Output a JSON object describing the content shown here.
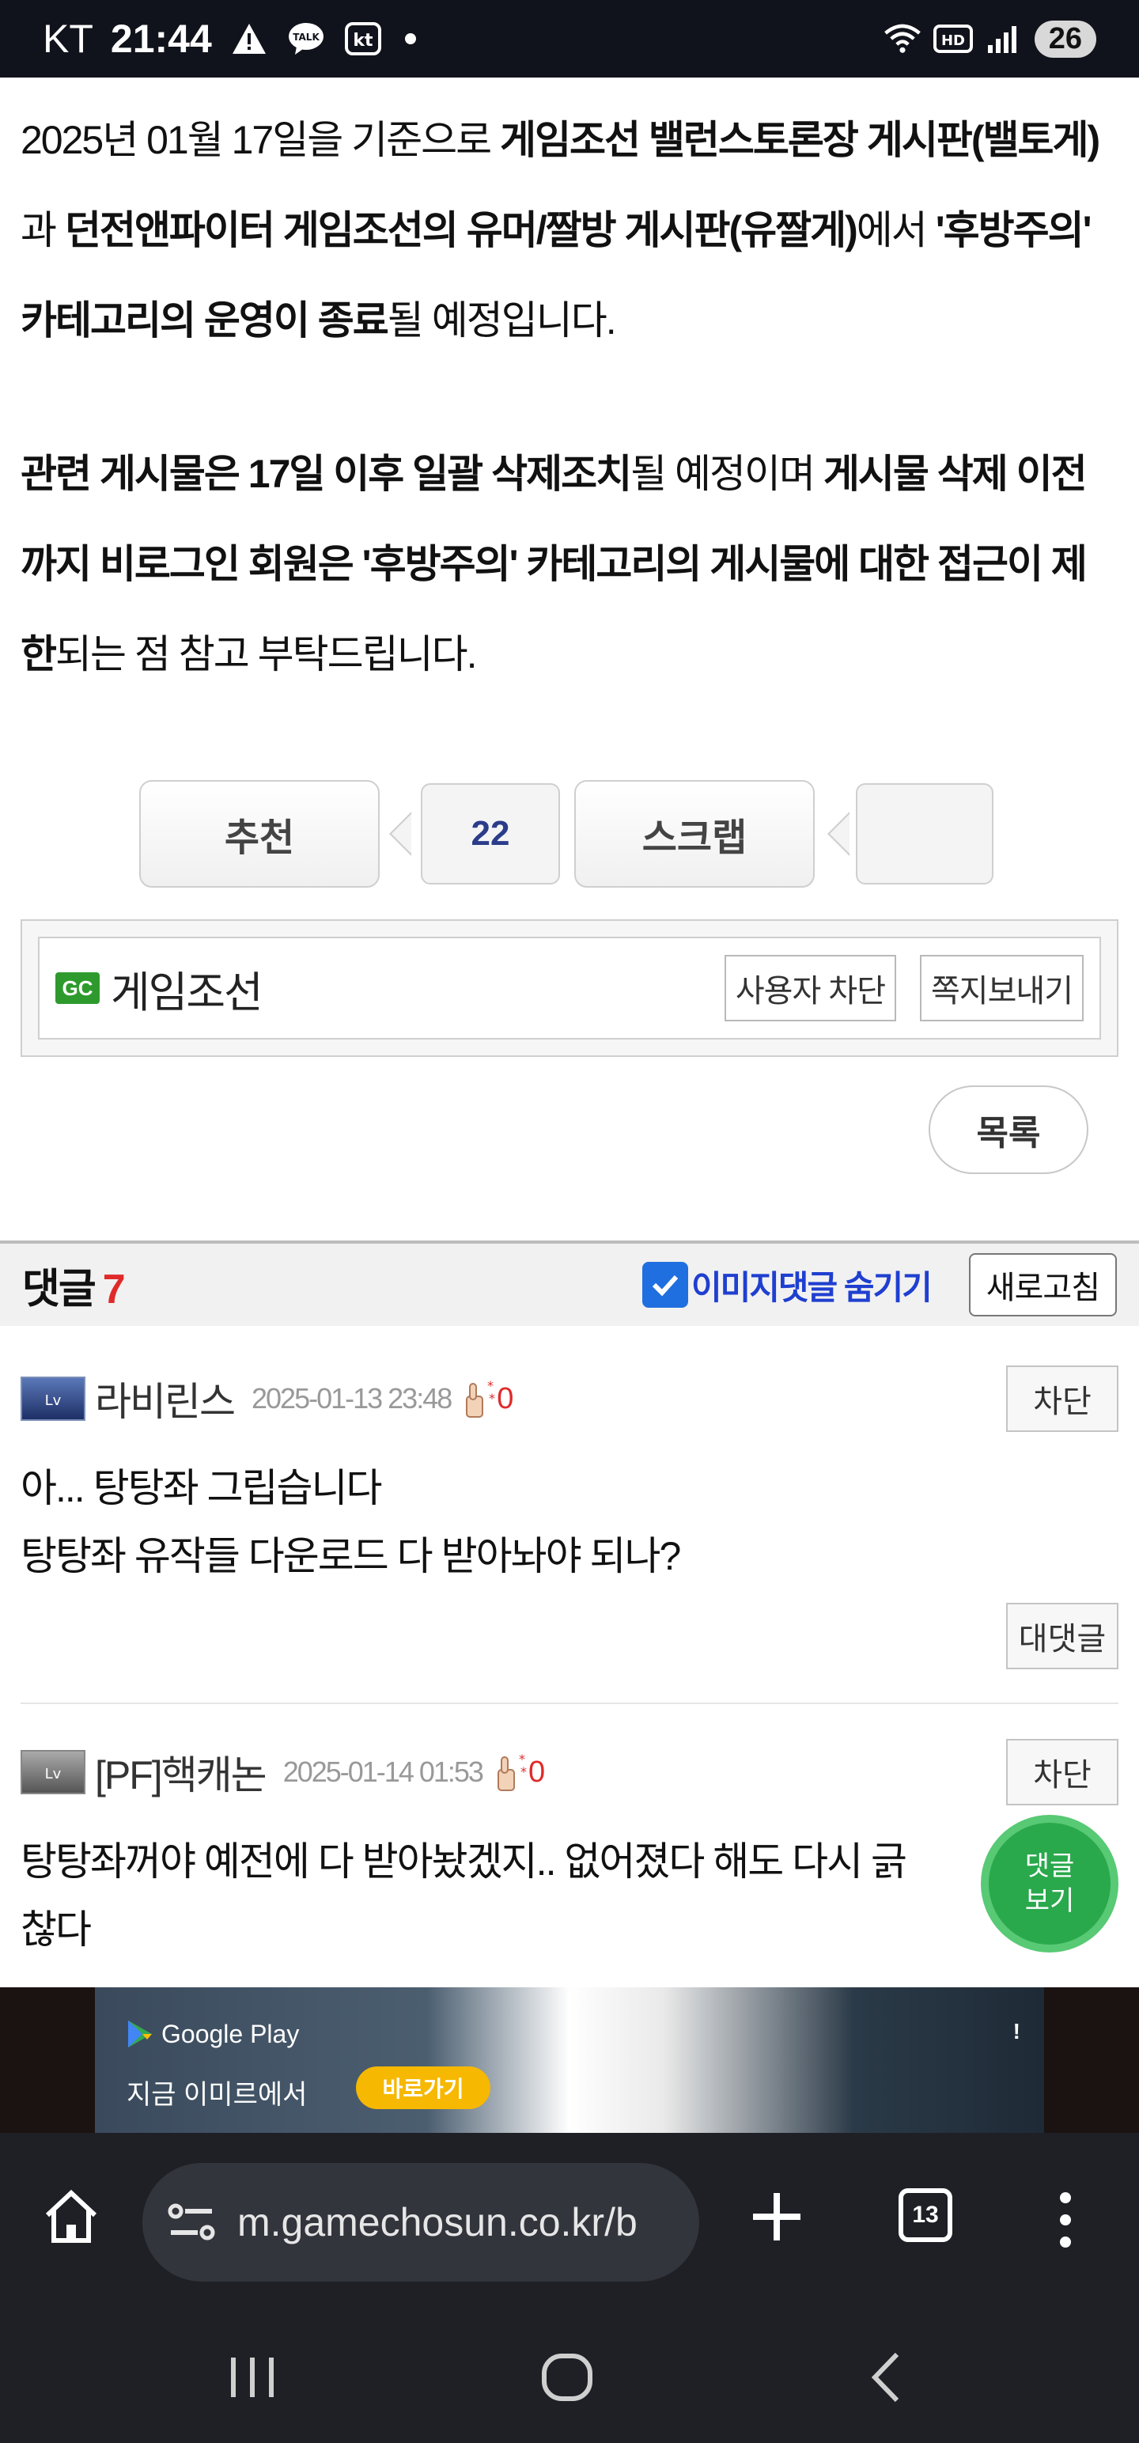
{
  "status_bar": {
    "carrier": "KT",
    "time": "21:44",
    "battery": "26",
    "icons": [
      "warning-icon",
      "talk-icon",
      "kt-icon",
      "dot-icon",
      "wifi-icon",
      "hd-icon",
      "signal-icon",
      "battery-icon"
    ]
  },
  "article": {
    "p1": [
      {
        "t": "2025년 01월 17일을 기준으로 ",
        "b": false
      },
      {
        "t": "게임조선 밸런스토론장 게시판(밸토게)",
        "b": true
      },
      {
        "t": "과 ",
        "b": false
      },
      {
        "t": "던전앤파이터 게임조선의 유머/짤방 게시판(유짤게)",
        "b": true
      },
      {
        "t": "에서 ",
        "b": false
      },
      {
        "t": "'후방주의' 카테고리의 운영이 종료",
        "b": true
      },
      {
        "t": "될 예정입니다.",
        "b": false
      }
    ],
    "p2": [
      {
        "t": "관련 게시물은 17일 이후 일괄 삭제조치",
        "b": true
      },
      {
        "t": "될 예정이며 ",
        "b": false
      },
      {
        "t": "게시물 삭제 이전까지 비로그인 회원은 '후방주의' 카테고리의 게시물에 대한 접근이 제한",
        "b": true
      },
      {
        "t": "되는 점 참고 부탁드립니다.",
        "b": false
      }
    ]
  },
  "vote": {
    "recommend_label": "추천",
    "recommend_count": "22",
    "scrap_label": "스크랩",
    "scrap_count": ""
  },
  "author": {
    "logo_text": "GC",
    "name": "게임조선",
    "block_label": "사용자 차단",
    "message_label": "쪽지보내기"
  },
  "list_label": "목록",
  "comments_header": {
    "title": "댓글",
    "count": "7",
    "hide_images_label": "이미지댓글 숨기기",
    "hide_images_checked": true,
    "refresh_label": "새로고침"
  },
  "comments": [
    {
      "badge": "",
      "name": "라비린스",
      "date": "2025-01-13 23:48",
      "likes": "0",
      "block_label": "차단",
      "body_lines": [
        "아... 탕탕좌 그립습니다",
        "탕탕좌 유작들 다운로드 다 받아놔야 되나?"
      ],
      "reply_label": "대댓글"
    },
    {
      "badge": "",
      "name": "[PF]핵캐논",
      "date": "2025-01-14 01:53",
      "likes": "0",
      "block_label": "차단",
      "body_lines": [
        "탕탕좌꺼야 예전에 다 받아놨겠지.. 없어졌다 해도 다시 긁",
        "찮다"
      ]
    }
  ],
  "float_button": {
    "line1": "댓글",
    "line2": "보기"
  },
  "ad": {
    "store": "Google Play",
    "subtitle": "지금 이미르에서",
    "cta": "바로가기",
    "info": "!"
  },
  "browser": {
    "url": "m.gamechosun.co.kr/b",
    "tab_count": "13"
  },
  "colors": {
    "status_bg": "#11131c",
    "accent_red": "#e02a2a",
    "link_blue": "#1f3fd0",
    "float_green": "#2aa84c",
    "browser_bg": "#1f2026"
  }
}
